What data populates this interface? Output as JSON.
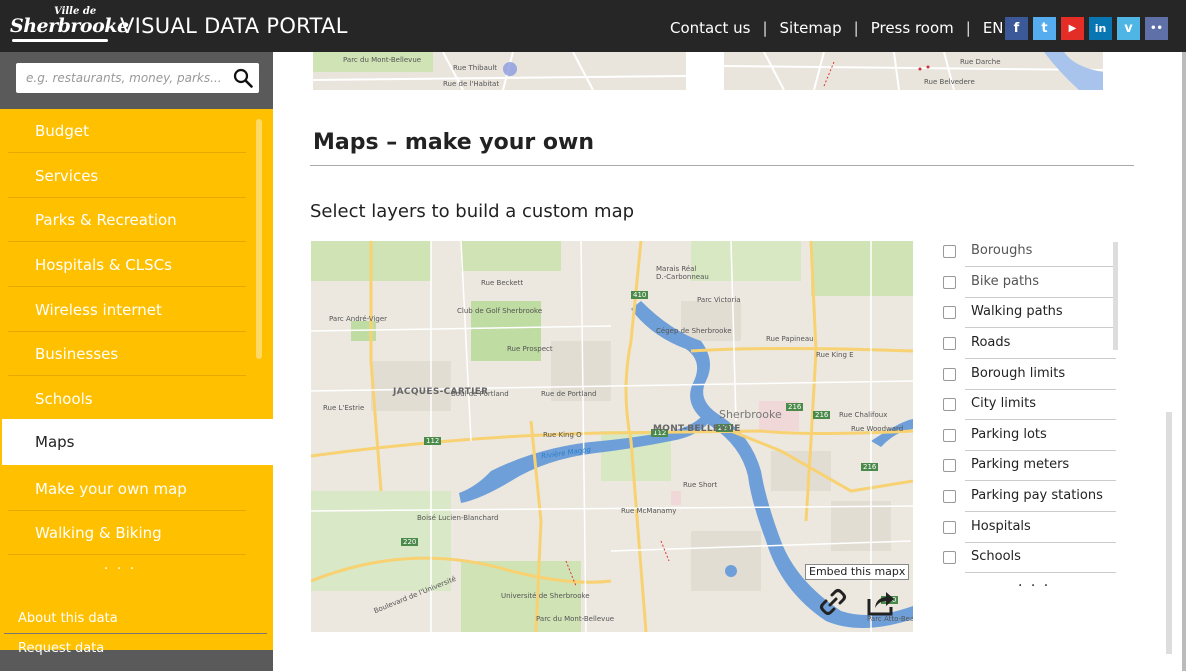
{
  "header": {
    "logo_small": "Ville de",
    "logo_main": "Sherbrooke",
    "title": "VISUAL DATA PORTAL",
    "nav": [
      "Contact us",
      "Sitemap",
      "Press room",
      "EN"
    ],
    "separator": "|",
    "social": [
      {
        "icon": "facebook-icon",
        "glyph": "f",
        "color": "#3b5998"
      },
      {
        "icon": "twitter-icon",
        "glyph": "t",
        "color": "#55acee"
      },
      {
        "icon": "youtube-icon",
        "glyph": "▶",
        "color": "#e52d27"
      },
      {
        "icon": "linkedin-icon",
        "glyph": "in",
        "color": "#0976b4"
      },
      {
        "icon": "vimeo-icon",
        "glyph": "v",
        "color": "#4eb5e4"
      },
      {
        "icon": "flickr-icon",
        "glyph": "••",
        "color": "#5f6fa8"
      }
    ]
  },
  "sidebar": {
    "search_placeholder": "e.g. restaurants, money, parks...",
    "items": [
      "Budget",
      "Services",
      "Parks & Recreation",
      "Hospitals & CLSCs",
      "Wireless internet",
      "Businesses",
      "Schools",
      "Maps",
      "Make your own map",
      "Walking & Biking"
    ],
    "active_item": "Maps",
    "more": "· · ·",
    "bottom": [
      "About this data",
      "Request data"
    ]
  },
  "colors": {
    "header_bg": "#262626",
    "menu_bg": "#ffc000",
    "sidebar_bg": "#5a5a5a",
    "map_water": "#6f9fd8",
    "map_road": "#f8d272"
  },
  "main": {
    "section_title": "Maps – make your own",
    "subtitle": "Select layers to build a custom map",
    "embed_tooltip": "Embed this mapx",
    "layers": [
      {
        "label": "Boroughs",
        "checked": false
      },
      {
        "label": "Bike paths",
        "checked": false
      },
      {
        "label": "Walking paths",
        "checked": false
      },
      {
        "label": "Roads",
        "checked": false
      },
      {
        "label": "Borough limits",
        "checked": false
      },
      {
        "label": "City limits",
        "checked": false
      },
      {
        "label": "Parking lots",
        "checked": false
      },
      {
        "label": "Parking meters",
        "checked": false
      },
      {
        "label": "Parking pay stations",
        "checked": false
      },
      {
        "label": "Hospitals",
        "checked": false
      },
      {
        "label": "Schools",
        "checked": false
      }
    ],
    "layers_more": "· · ·"
  },
  "map": {
    "labels": {
      "jacques_cartier": "JACQUES-CARTIER",
      "mont_bellevue": "MONT-BELLEVUE",
      "sherbrooke": "Sherbrooke",
      "riviere_magog": "Rivière Magog",
      "club_golf": "Club de Golf Sherbrooke",
      "parc_andre_viger": "Parc André-Viger",
      "marais_real": "Marais Réal",
      "carbonneau": "D.-Carbonneau",
      "parc_victoria": "Parc Victoria",
      "cegep": "Cégep de Sherbrooke",
      "rue_king_o": "Rue King O",
      "rue_king_e": "Rue King E",
      "boul_portland": "Boul de Portland",
      "rue_portland": "Rue de Portland",
      "rue_prospect": "Rue Prospect",
      "rue_belvedere": "Rue Belvédère N",
      "rue_papineau": "Rue Papineau",
      "boise_lucien": "Boisé Lucien-Blanchard",
      "universite": "Université de Sherbrooke",
      "boul_universite": "Boulevard de l'Université",
      "rue_mcmanamy": "Rue McManamy",
      "rue_short": "Rue Short",
      "rue_lestrie": "Rue L'Estrie",
      "rue_beckett": "Rue Beckett",
      "rue_galt": "Rue Galt O",
      "boul_queen_victoria": "Boul Queen-Victoria",
      "rue_wellington": "Rue Wellington S",
      "rue_woodward": "Rue Woodward",
      "rue_chalifoux": "Rue Chalifoux",
      "parc_mont_bellevue": "Parc du Mont-Bellevue",
      "parc_atto_beaver": "Parc Atto-Beaver",
      "rue_mccrea": "Rue McCrea",
      "rue_galt_e": "Rue Galt E"
    },
    "shields": [
      "410",
      "112",
      "112",
      "220",
      "216",
      "216",
      "216",
      "220",
      "410"
    ]
  },
  "top_thumbs": {
    "left_labels": [
      "Parc du Mont-Bellevue",
      "Rue Thibault",
      "Rue de l'Habitat"
    ],
    "right_labels": [
      "Rue Darche",
      "Rue Belvedere"
    ]
  }
}
